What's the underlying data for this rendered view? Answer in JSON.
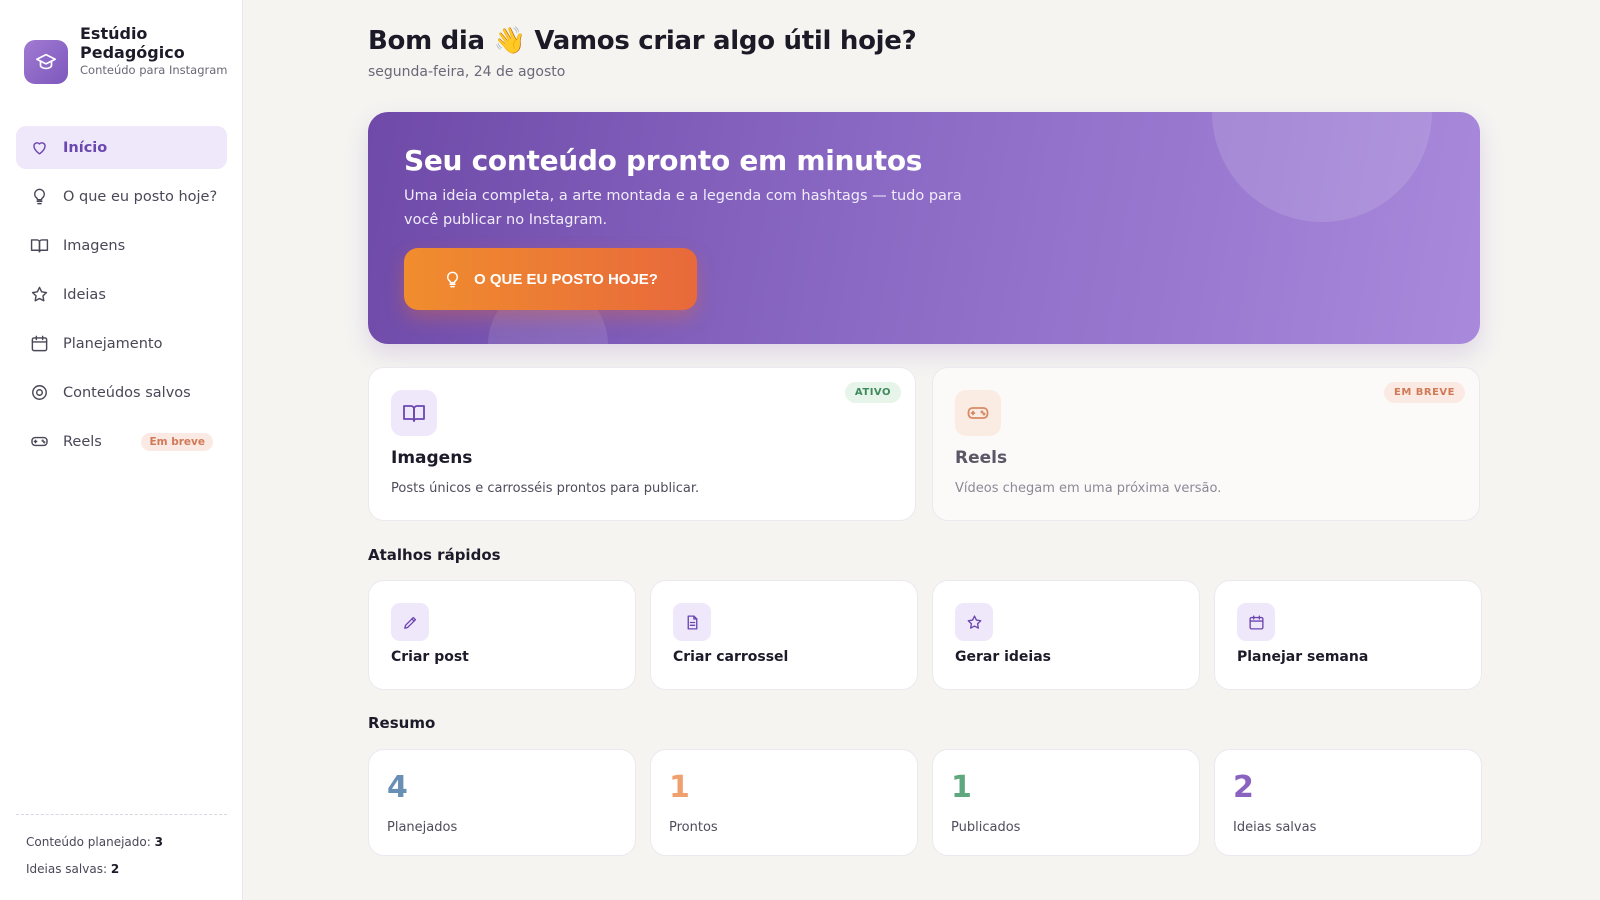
{
  "brand": {
    "title": "Estúdio Pedagógico",
    "subtitle": "Conteúdo para Instagram"
  },
  "sidebar": {
    "items": [
      {
        "label": "Início",
        "icon": "heart-icon",
        "active": true
      },
      {
        "label": "O que eu posto hoje?",
        "icon": "lightbulb-icon"
      },
      {
        "label": "Imagens",
        "icon": "book-open-icon"
      },
      {
        "label": "Ideias",
        "icon": "star-icon"
      },
      {
        "label": "Planejamento",
        "icon": "calendar-icon"
      },
      {
        "label": "Conteúdos salvos",
        "icon": "target-icon"
      },
      {
        "label": "Reels",
        "icon": "gamepad-icon",
        "badge": "Em breve"
      }
    ],
    "footer": {
      "planned_label": "Conteúdo planejado:",
      "planned_value": "3",
      "ideas_label": "Ideias salvas:",
      "ideas_value": "2"
    }
  },
  "header": {
    "greeting": "Bom dia 👋 Vamos criar algo útil hoje?",
    "date": "segunda-feira, 24 de agosto"
  },
  "hero": {
    "title": "Seu conteúdo pronto em minutos",
    "description": "Uma ideia completa, a arte montada e a legenda com hashtags — tudo para você publicar no Instagram.",
    "button_label": "O QUE EU POSTO HOJE?",
    "button_icon": "lightbulb-icon"
  },
  "features": [
    {
      "title": "Imagens",
      "description": "Posts únicos e carrosséis prontos para publicar.",
      "badge": "ATIVO",
      "icon": "book-open-icon"
    },
    {
      "title": "Reels",
      "description": "Vídeos chegam em uma próxima versão.",
      "badge": "EM BREVE",
      "icon": "gamepad-icon"
    }
  ],
  "shortcuts": {
    "title": "Atalhos rápidos",
    "items": [
      {
        "label": "Criar post",
        "icon": "pencil-icon"
      },
      {
        "label": "Criar carrossel",
        "icon": "document-icon"
      },
      {
        "label": "Gerar ideias",
        "icon": "star-icon"
      },
      {
        "label": "Planejar semana",
        "icon": "calendar-icon"
      }
    ]
  },
  "summary": {
    "title": "Resumo",
    "items": [
      {
        "value": "4",
        "label": "Planejados",
        "color": "#6a8fb5"
      },
      {
        "value": "1",
        "label": "Prontos",
        "color": "#f0a06e"
      },
      {
        "value": "1",
        "label": "Publicados",
        "color": "#5fa77c"
      },
      {
        "value": "2",
        "label": "Ideias salvas",
        "color": "#8a63c0"
      }
    ]
  },
  "colors": {
    "accent": "#6b47b0",
    "hero_start": "#6f4aa8",
    "hero_end": "#a889db",
    "cta_start": "#f08d2e",
    "cta_end": "#e8693b",
    "active_badge_bg": "#e6f4ea",
    "active_badge_fg": "#3f8a5a",
    "soon_badge_bg": "#fbeae3",
    "soon_badge_fg": "#d07a58"
  }
}
